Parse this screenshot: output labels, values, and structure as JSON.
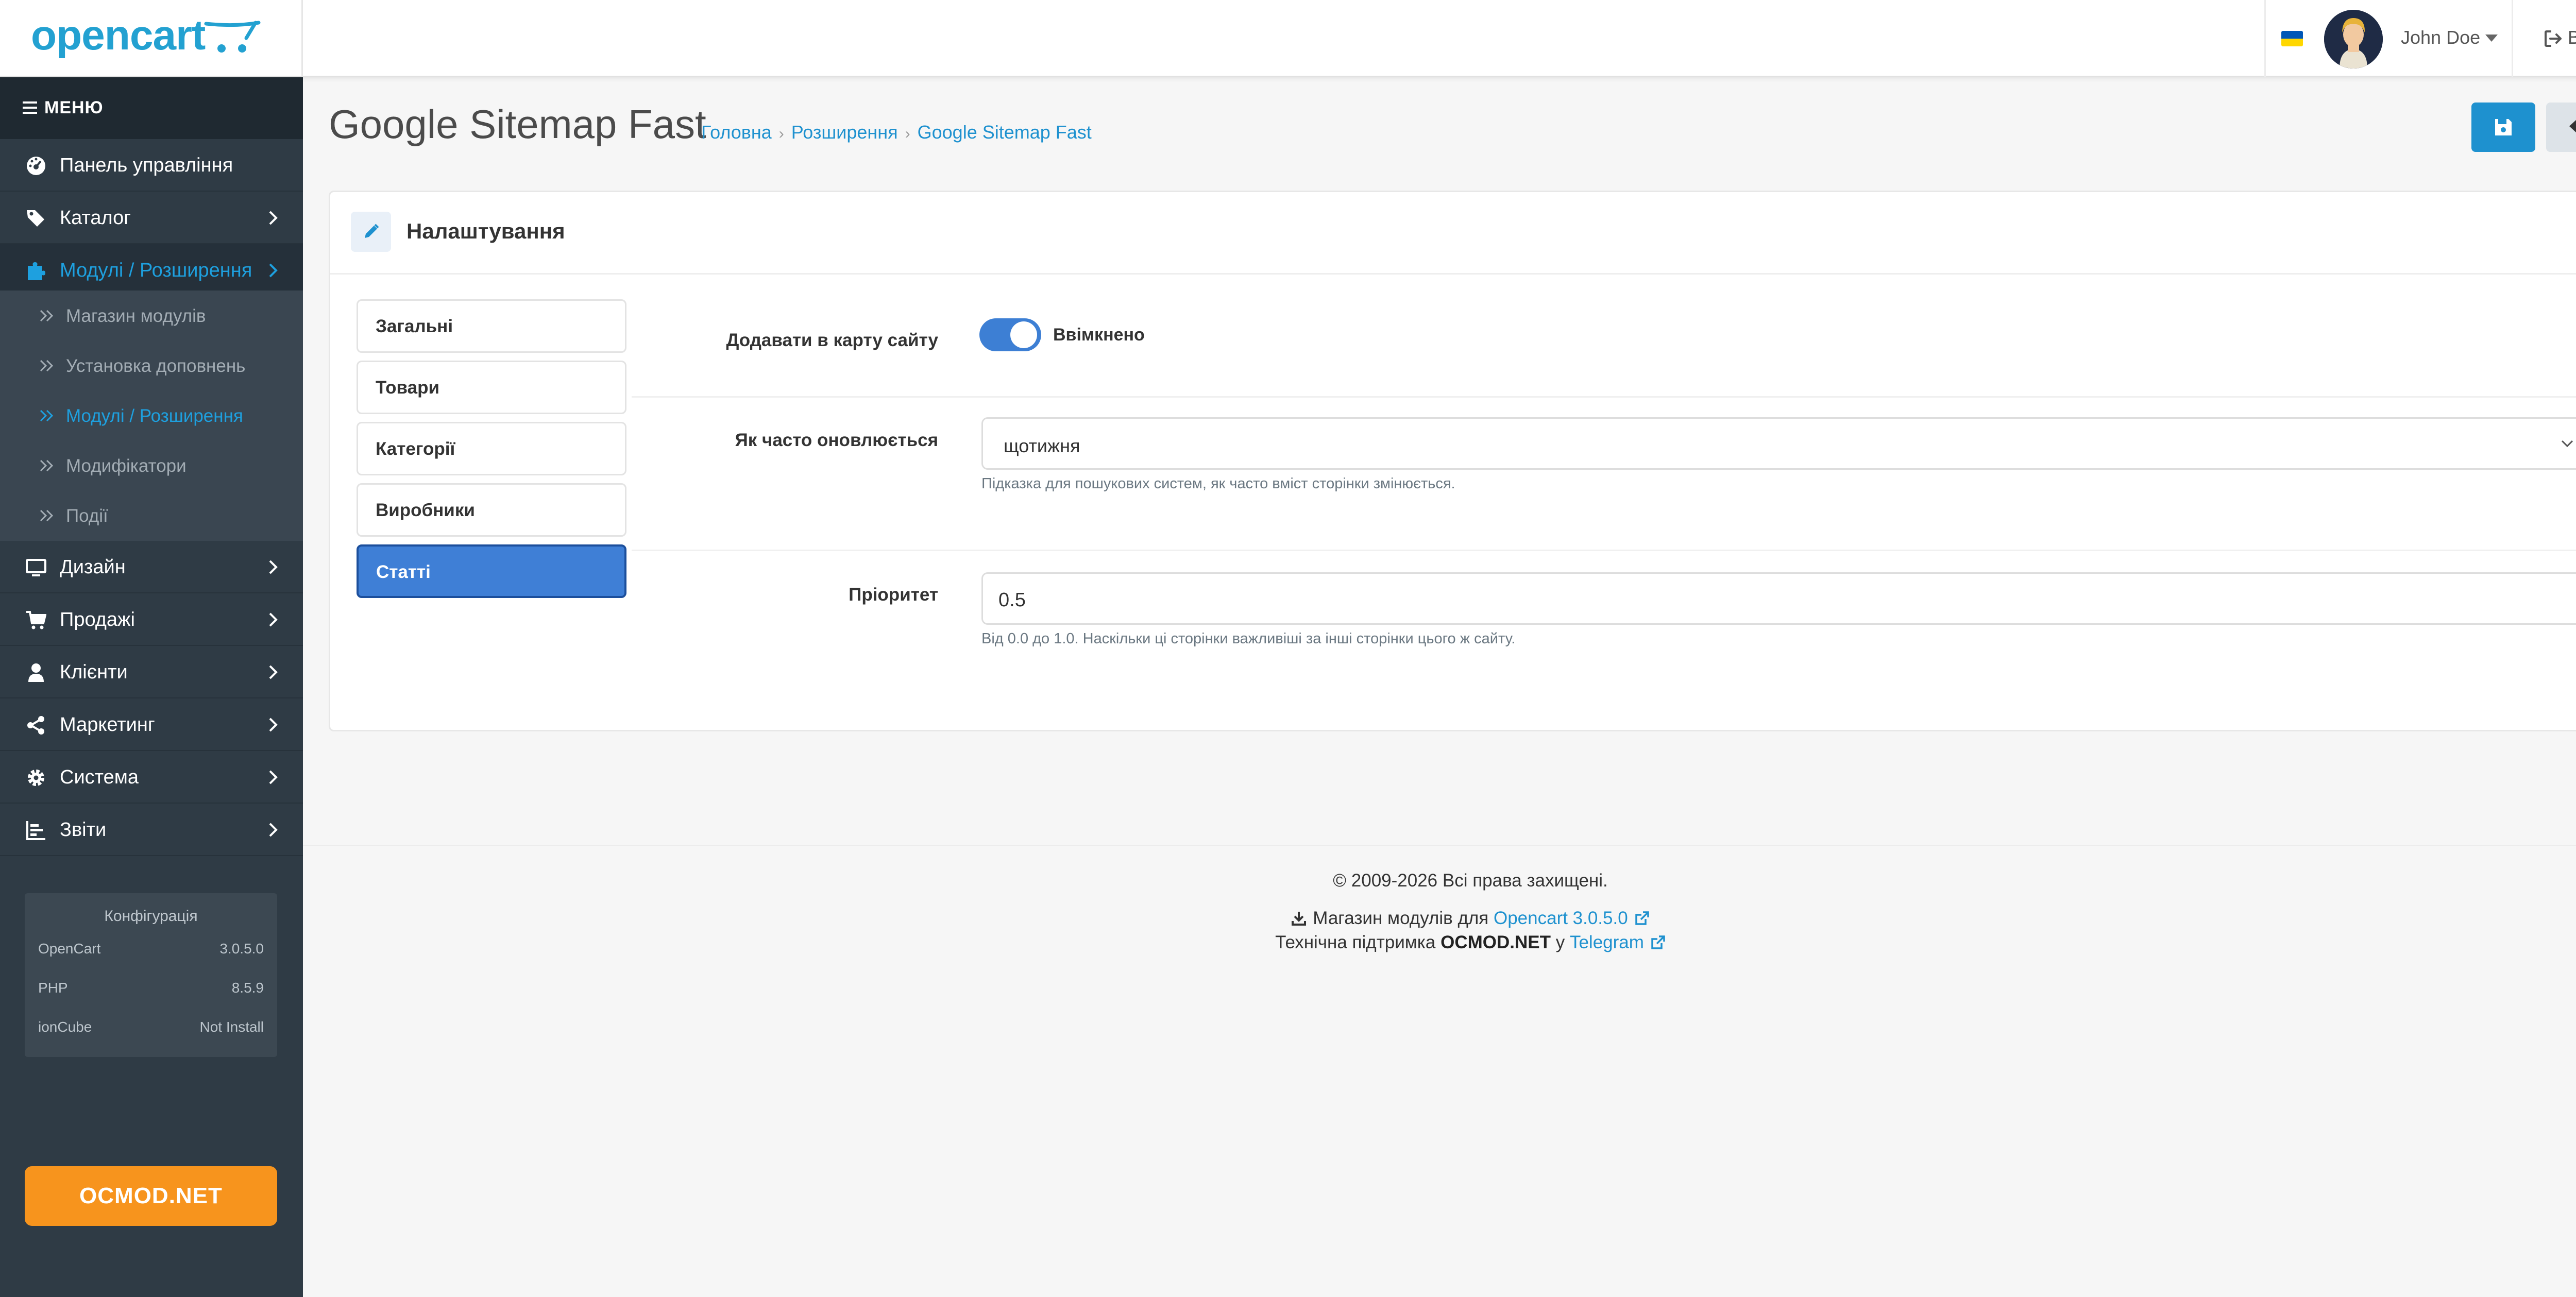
{
  "header": {
    "brand": "opencart",
    "language": "Українська",
    "user_name": "John Doe",
    "logout": "Вихід"
  },
  "sidebar": {
    "menu_label": "МЕНЮ",
    "items": [
      {
        "label": "Панель управління",
        "icon": "dashboard-icon"
      },
      {
        "label": "Каталог",
        "icon": "tags-icon"
      },
      {
        "label": "Модулі / Розширення",
        "icon": "puzzle-icon",
        "active": true
      },
      {
        "label": "Дизайн",
        "icon": "monitor-icon"
      },
      {
        "label": "Продажі",
        "icon": "shopping-cart-icon"
      },
      {
        "label": "Клієнти",
        "icon": "user-icon"
      },
      {
        "label": "Маркетинг",
        "icon": "share-icon"
      },
      {
        "label": "Система",
        "icon": "gear-icon"
      },
      {
        "label": "Звіти",
        "icon": "bar-chart-icon"
      }
    ],
    "submenu": [
      {
        "label": "Магазин модулів"
      },
      {
        "label": "Установка доповнень"
      },
      {
        "label": "Модулі / Розширення",
        "active": true
      },
      {
        "label": "Модифікатори"
      },
      {
        "label": "Події"
      }
    ],
    "config": {
      "title": "Конфігурація",
      "rows": [
        {
          "key": "OpenCart",
          "value": "3.0.5.0"
        },
        {
          "key": "PHP",
          "value": "8.5.9"
        },
        {
          "key": "ionCube",
          "value": "Not Install"
        }
      ]
    },
    "ocmod_button": "OCMOD.NET"
  },
  "page": {
    "title": "Google Sitemap Fast",
    "breadcrumb": [
      "Головна",
      "Розширення",
      "Google Sitemap Fast"
    ]
  },
  "panel": {
    "title": "Налаштування",
    "tabs": [
      "Загальні",
      "Товари",
      "Категорії",
      "Виробники",
      "Статті"
    ],
    "active_tab": "Статті",
    "fields": {
      "add_to_sitemap": {
        "label": "Додавати в карту сайту",
        "state_text": "Ввімкнено",
        "enabled": true
      },
      "changefreq": {
        "label": "Як часто оновлюється",
        "value": "щотижня",
        "help": "Підказка для пошукових систем, як часто вміст сторінки змінюється."
      },
      "priority": {
        "label": "Пріоритет",
        "value": "0.5",
        "help": "Від 0.0 до 1.0. Наскільки ці сторінки важливіші за інші сторінки цього ж сайту."
      }
    }
  },
  "footer": {
    "copyright": "© 2009-2026 Всі права захищені.",
    "store_text": "Магазин модулів для",
    "store_link": "Opencart 3.0.5.0",
    "support_text": "Технічна підтримка",
    "support_brand": "OCMOD.NET",
    "support_connector": "у",
    "support_link": "Telegram"
  },
  "colors": {
    "brand_blue": "#23a1d1",
    "sidebar_bg": "#2f3b45",
    "accent": "#1e91cf",
    "active_tab": "#3f7fd6",
    "ocmod_orange": "#f7941d"
  }
}
